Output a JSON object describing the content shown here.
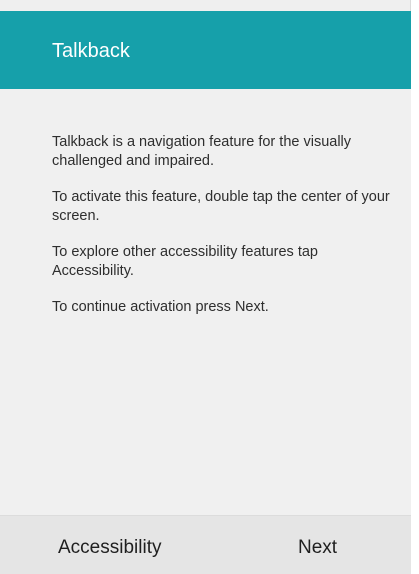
{
  "app_bar": {
    "title": "Talkback"
  },
  "content": {
    "paragraphs": [
      "Talkback is a navigation feature for the visually challenged and impaired.",
      "To activate this feature, double tap the center of your screen.",
      "To explore other accessibility features tap Accessibility.",
      "To continue activation press Next."
    ]
  },
  "footer": {
    "left_button": "Accessibility",
    "right_button": "Next"
  },
  "colors": {
    "app_bar": "#16a0aa",
    "background": "#f0f0f0",
    "footer": "#e5e5e5"
  }
}
